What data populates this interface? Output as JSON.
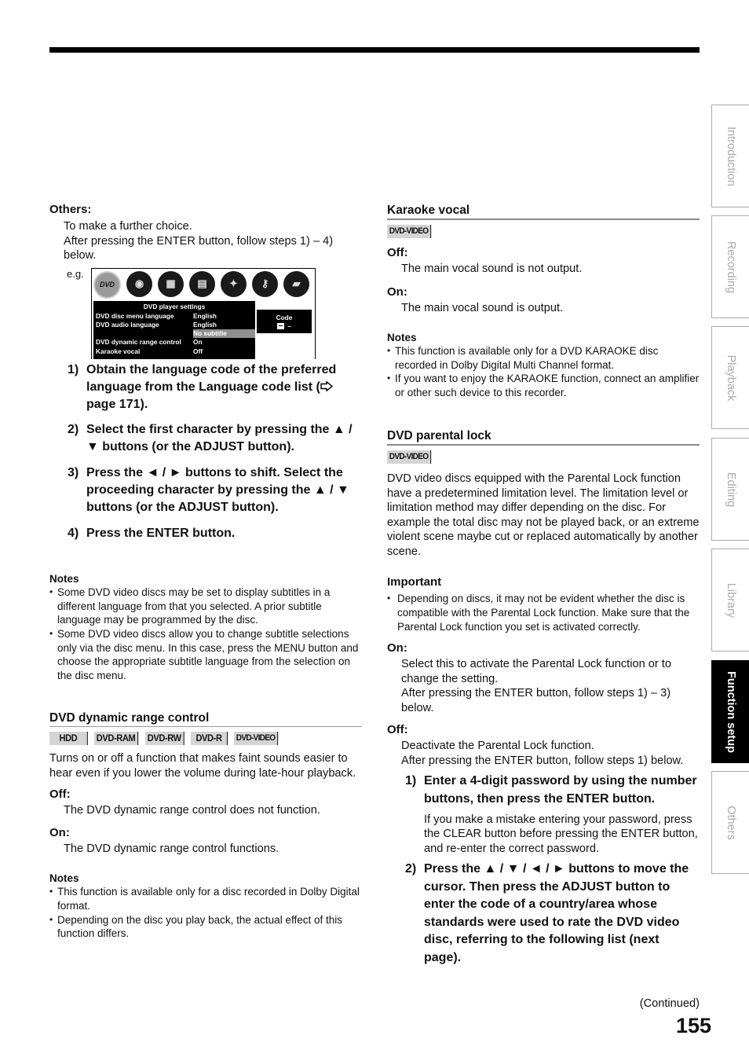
{
  "side_tabs": [
    {
      "label": "Introduction",
      "active": false
    },
    {
      "label": "Recording",
      "active": false
    },
    {
      "label": "Playback",
      "active": false
    },
    {
      "label": "Editing",
      "active": false
    },
    {
      "label": "Library",
      "active": false
    },
    {
      "label": "Function setup",
      "active": true
    },
    {
      "label": "Others",
      "active": false
    }
  ],
  "left": {
    "others": {
      "label": "Others:",
      "lines": [
        "To make a further choice.",
        "After pressing the ENTER button, follow steps 1) – 4) below."
      ]
    },
    "example": {
      "eg_label": "e.g.",
      "icons": [
        "dvd-video-icon",
        "speaker-icon",
        "picture-icon",
        "remote-icon",
        "disc-arrow-icon",
        "keys-icon",
        "player-icon"
      ],
      "menu_title": "DVD player settings",
      "rows": [
        {
          "key": "DVD disc menu language",
          "value": "English"
        },
        {
          "key": "DVD audio language",
          "value": "English"
        },
        {
          "key": "",
          "value": "No subtitle"
        },
        {
          "key": "DVD dynamic range control",
          "value": "On"
        },
        {
          "key": "Karaoke vocal",
          "value": "Off"
        }
      ],
      "code_label": "Code",
      "code_value": "–"
    },
    "steps": [
      {
        "num": "1)",
        "text_a": "Obtain the language code of the preferred language from the Language code list (",
        "text_b": " page 171)."
      },
      {
        "num": "2)",
        "text": "Select the first character by pressing the ▲ / ▼ buttons (or the ADJUST button)."
      },
      {
        "num": "3)",
        "text": "Press the ◄ / ► buttons to shift. Select the proceeding character by pressing the ▲ / ▼ buttons (or the ADJUST button)."
      },
      {
        "num": "4)",
        "text": "Press the ENTER button."
      }
    ],
    "notes1": {
      "title": "Notes",
      "items": [
        "Some DVD video discs may be set to display subtitles in a different language from that you selected. A prior subtitle language may be programmed by the disc.",
        "Some DVD video discs allow you to change subtitle selections only via the disc menu. In this case, press the MENU button and choose the appropriate subtitle language from the selection on the disc menu."
      ]
    },
    "drc": {
      "title": "DVD dynamic range control",
      "badges": [
        "HDD",
        "DVD-RAM",
        "DVD-RW",
        "DVD-R",
        "DVD-VIDEO"
      ],
      "desc": "Turns on or off a function that makes faint sounds easier to hear even if you lower the volume during late-hour playback.",
      "off_label": "Off:",
      "off_text": "The DVD dynamic range control does not function.",
      "on_label": "On:",
      "on_text": "The DVD dynamic range control functions."
    },
    "notes2": {
      "title": "Notes",
      "items": [
        "This function is available only for a disc recorded in Dolby Digital format.",
        "Depending on the disc you play back, the actual effect of this function differs."
      ]
    }
  },
  "right": {
    "karaoke": {
      "title": "Karaoke vocal",
      "badge": "DVD-VIDEO",
      "off_label": "Off:",
      "off_text": "The main vocal sound is not output.",
      "on_label": "On:",
      "on_text": "The main vocal sound is output."
    },
    "notes": {
      "title": "Notes",
      "items": [
        "This function is available only for a DVD KARAOKE disc recorded in Dolby Digital Multi Channel format.",
        "If you want to enjoy the KARAOKE function, connect an amplifier or other such device to this recorder."
      ]
    },
    "parental": {
      "title": "DVD parental lock",
      "badge": "DVD-VIDEO",
      "desc": "DVD video discs equipped with the Parental Lock function have a predetermined limitation level. The limitation level or limitation method may differ depending on the disc. For example the total disc may not be played back, or an extreme violent scene maybe cut or replaced automatically by another scene.",
      "important_title": "Important",
      "important_items": [
        "Depending on discs, it may not be evident whether the disc is compatible with the Parental Lock function. Make sure that the Parental Lock function you set is activated correctly."
      ],
      "on_label": "On:",
      "on_lines": [
        "Select this to activate the Parental Lock function or to change the setting.",
        "After pressing the ENTER button, follow steps 1) – 3) below."
      ],
      "off_label": "Off:",
      "off_lines": [
        "Deactivate the Parental Lock function.",
        "After pressing the ENTER button, follow steps 1) below."
      ],
      "steps": [
        {
          "num": "1)",
          "text": "Enter a 4-digit password by using the number buttons, then press the ENTER button.",
          "sub": "If you make a mistake entering your password, press the CLEAR button before pressing the ENTER button, and re-enter the correct password."
        },
        {
          "num": "2)",
          "text": "Press the ▲ / ▼ / ◄ / ► buttons to move the cursor. Then press the ADJUST button to enter the code of a country/area whose standards were used to rate the DVD video disc, referring to the following list (next page)."
        }
      ]
    }
  },
  "footer": {
    "continued": "(Continued)",
    "page_number": "155"
  }
}
